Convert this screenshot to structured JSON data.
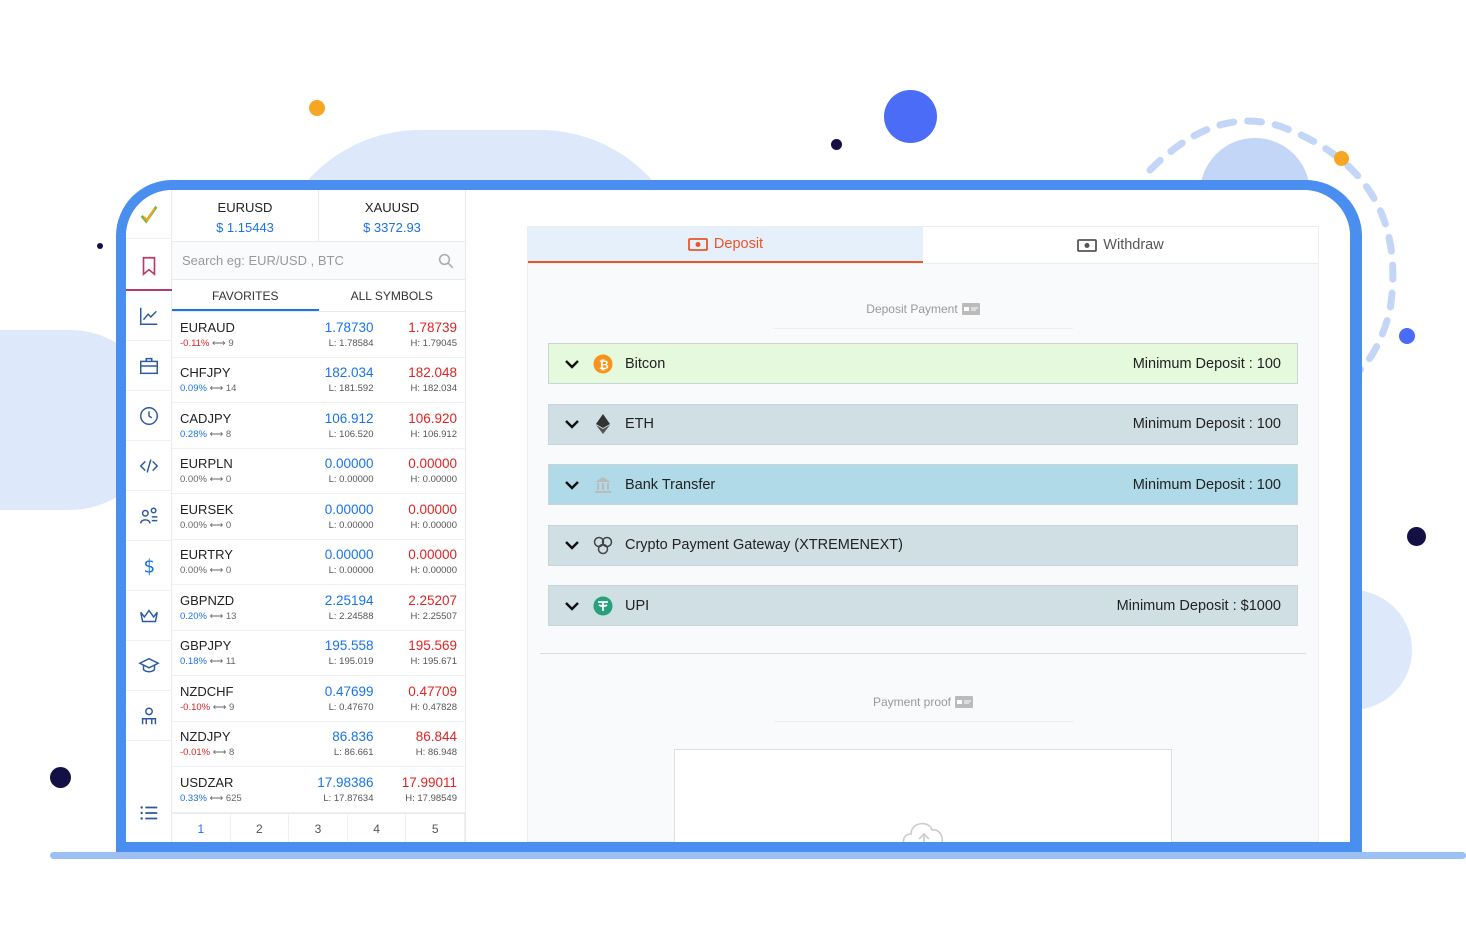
{
  "colors": {
    "accent_blue": "#1a73e8",
    "ask_red": "#e02424",
    "deposit_orange": "#e9562b",
    "bitcoin_bg": "#e5f9dc",
    "eth_bg": "#cfdfe3",
    "bank_bg": "#b0dae7",
    "crypto_gateway_bg": "#cfdfe3",
    "upi_bg": "#cfdfe3"
  },
  "tickers": [
    {
      "symbol": "EURUSD",
      "price": "$ 1.15443"
    },
    {
      "symbol": "XAUUSD",
      "price": "$ 3372.93"
    }
  ],
  "search": {
    "placeholder": "Search eg: EUR/USD , BTC",
    "icon": "search-icon"
  },
  "tabs": {
    "favorites": "FAVORITES",
    "all_symbols": "ALL SYMBOLS"
  },
  "symbols": [
    {
      "name": "EURAUD",
      "change": "-0.11%",
      "spread": "9",
      "bid": "1.78730",
      "low": "L: 1.78584",
      "ask": "1.78739",
      "high": "H: 1.79045",
      "dir": "down"
    },
    {
      "name": "CHFJPY",
      "change": "0.09%",
      "spread": "14",
      "bid": "182.034",
      "low": "L: 181.592",
      "ask": "182.048",
      "high": "H: 182.034",
      "dir": "up"
    },
    {
      "name": "CADJPY",
      "change": "0.28%",
      "spread": "8",
      "bid": "106.912",
      "low": "L: 106.520",
      "ask": "106.920",
      "high": "H: 106.912",
      "dir": "up"
    },
    {
      "name": "EURPLN",
      "change": "0.00%",
      "spread": "0",
      "bid": "0.00000",
      "low": "L: 0.00000",
      "ask": "0.00000",
      "high": "H: 0.00000",
      "dir": "flat"
    },
    {
      "name": "EURSEK",
      "change": "0.00%",
      "spread": "0",
      "bid": "0.00000",
      "low": "L: 0.00000",
      "ask": "0.00000",
      "high": "H: 0.00000",
      "dir": "flat"
    },
    {
      "name": "EURTRY",
      "change": "0.00%",
      "spread": "0",
      "bid": "0.00000",
      "low": "L: 0.00000",
      "ask": "0.00000",
      "high": "H: 0.00000",
      "dir": "flat"
    },
    {
      "name": "GBPNZD",
      "change": "0.20%",
      "spread": "13",
      "bid": "2.25194",
      "low": "L: 2.24588",
      "ask": "2.25207",
      "high": "H: 2.25507",
      "dir": "up"
    },
    {
      "name": "GBPJPY",
      "change": "0.18%",
      "spread": "11",
      "bid": "195.558",
      "low": "L: 195.019",
      "ask": "195.569",
      "high": "H: 195.671",
      "dir": "up"
    },
    {
      "name": "NZDCHF",
      "change": "-0.10%",
      "spread": "9",
      "bid": "0.47699",
      "low": "L: 0.47670",
      "ask": "0.47709",
      "high": "H: 0.47828",
      "dir": "down"
    },
    {
      "name": "NZDJPY",
      "change": "-0.01%",
      "spread": "8",
      "bid": "86.836",
      "low": "L: 86.661",
      "ask": "86.844",
      "high": "H: 86.948",
      "dir": "down"
    },
    {
      "name": "USDZAR",
      "change": "0.33%",
      "spread": "625",
      "bid": "17.98386",
      "low": "L: 17.87634",
      "ask": "17.99011",
      "high": "H: 17.98549",
      "dir": "up"
    }
  ],
  "pager": [
    "1",
    "2",
    "3",
    "4",
    "5"
  ],
  "rail_icons": [
    "logo-icon",
    "bookmark-icon",
    "chart-line-icon",
    "briefcase-icon",
    "history-icon",
    "code-icon",
    "users-icon",
    "dollar-icon",
    "crown-icon",
    "graduation-cap-icon",
    "agent-icon",
    "list-icon"
  ],
  "card": {
    "deposit_tab": "Deposit",
    "withdraw_tab": "Withdraw",
    "deposit_payment": "Deposit Payment",
    "payment_proof": "Payment proof"
  },
  "methods": [
    {
      "name": "Bitcon",
      "min": "Minimum Deposit : 100",
      "icon": "bitcoin-icon"
    },
    {
      "name": "ETH",
      "min": "Minimum Deposit : 100",
      "icon": "ethereum-icon"
    },
    {
      "name": "Bank Transfer",
      "min": "Minimum Deposit : 100",
      "icon": "bank-icon"
    },
    {
      "name": "Crypto Payment Gateway (XTREMENEXT)",
      "min": "",
      "icon": "crypto-gateway-icon"
    },
    {
      "name": "UPI",
      "min": "Minimum Deposit : $1000",
      "icon": "tether-icon"
    }
  ]
}
